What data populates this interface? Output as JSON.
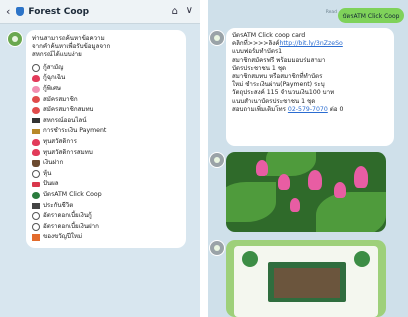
{
  "header": {
    "back_icon": "chevron-left-icon",
    "title": "Forest Coop",
    "home_icon": "home-icon",
    "dropdown_icon": "chevron-down-icon"
  },
  "menu": {
    "intro_lines": [
      "ท่านสามารถค้นหาข้อความ",
      "จากคำค้นหาเพื่อรับข้อมูลจาก",
      "สหกรณ์ได้แบบง่าย"
    ],
    "items": [
      {
        "icon": "circle-icon",
        "label": "กู้สามัญ"
      },
      {
        "icon": "heart-icon",
        "label": "กู้ฉุกเฉิน"
      },
      {
        "icon": "pig-icon",
        "label": "กู้พิเศษ"
      },
      {
        "icon": "flower-icon",
        "label": "สมัครสมาชิก"
      },
      {
        "icon": "flower-icon",
        "label": "สมัครสมาชิกสมทบ"
      },
      {
        "icon": "laptop-icon",
        "label": "สหกรณ์ออนไลน์"
      },
      {
        "icon": "money-icon",
        "label": "การชำระเงิน Payment"
      },
      {
        "icon": "heart-icon",
        "label": "ทุนสวัสดิการ"
      },
      {
        "icon": "heart-icon",
        "label": "ทุนสวัสดิการสมทบ"
      },
      {
        "icon": "bag-icon",
        "label": "เงินฝาก"
      },
      {
        "icon": "circle-icon",
        "label": "หุ้น"
      },
      {
        "icon": "card-icon",
        "label": "ปันผล"
      },
      {
        "icon": "chat-icon",
        "label": "บัตรATM Click Coop"
      },
      {
        "icon": "book-icon",
        "label": "ประกันชีวิต"
      },
      {
        "icon": "circle-icon",
        "label": "อัตราดอกเบี้ยเงินกู้"
      },
      {
        "icon": "circle-icon",
        "label": "อัตราดอกเบี้ยเงินฝาก"
      },
      {
        "icon": "gift-icon",
        "label": "ของขวัญปีใหม่"
      }
    ]
  },
  "chat": {
    "outgoing_message": "บัตรATM Click Coop",
    "read_status": "Read",
    "read_time": "",
    "card_message": {
      "lines": [
        "บัตรATM Click coop card",
        "คลิกที่>>>>ลิงค์",
        "แบบฟอร์มทำบัตร1",
        "สมาชิกสมัครฟรี พร้อมมอบร่มสามา",
        "บัตรประชาชน 1 ชุด",
        "สมาชิกสมทบ หรือสมาชิกที่ทำบัตร",
        "ใหม่ ชำระเงินผ่าน(Payment) ระบุ",
        "วัตถุประสงค์ 115 จำนวนเงิน100 บาท",
        "แนบสำเนาบัตรประชาชน 1 ชุด",
        "สอบถามเพิ่มเติมโทร"
      ],
      "link": "http://bit.ly/3nZzeSo",
      "phone": "02-579-7070",
      "phone_suffix": "ต่อ 0"
    }
  },
  "icons": {
    "avatar_primary": "forest-coop-avatar-icon",
    "avatar_secondary": "coop-avatar-icon"
  },
  "colors": {
    "header_bg": "#eef3f6",
    "chat_bg": "#d8e6ef",
    "outgoing_bubble": "#7fd25a",
    "link": "#2a6cd1"
  }
}
